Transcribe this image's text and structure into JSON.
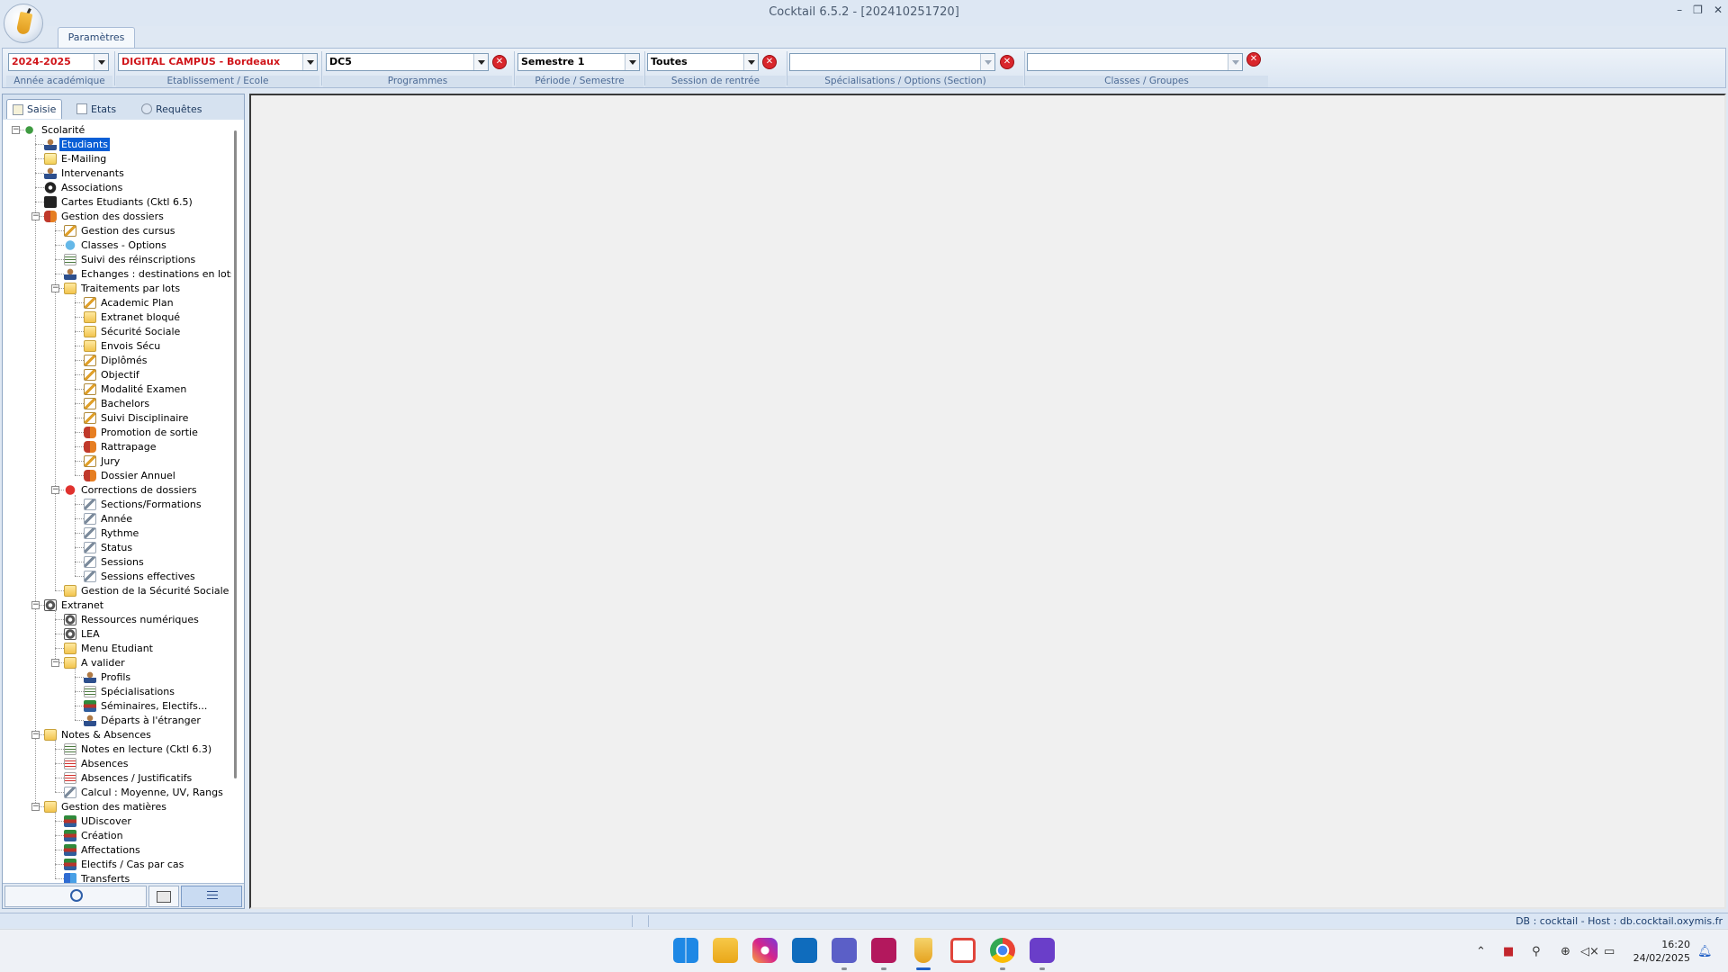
{
  "window": {
    "title": "Cocktail 6.5.2 -   [202410251720]",
    "controls": [
      "–",
      "❐",
      "✕"
    ]
  },
  "ribbon": {
    "tab_label": "Paramètres",
    "fields": [
      {
        "value": "2024-2025",
        "caption": "Année académique",
        "red": true
      },
      {
        "value": "DIGITAL CAMPUS - Bordeaux",
        "caption": "Etablissement / Ecole",
        "red": true
      },
      {
        "value": "DC5",
        "caption": "Programmes",
        "red": false
      },
      {
        "value": "Semestre 1",
        "caption": "Période / Semestre",
        "red": false
      },
      {
        "value": "Toutes",
        "caption": "Session de rentrée",
        "red": false
      },
      {
        "value": "",
        "caption": "Spécialisations / Options (Section)",
        "red": false
      },
      {
        "value": "",
        "caption": "Classes / Groupes",
        "red": false
      }
    ]
  },
  "left_panel": {
    "tabs": [
      "Saisie",
      "Etats",
      "Requêtes"
    ],
    "active_tab": "Saisie",
    "tree": [
      {
        "label": "Scolarité",
        "level": 0,
        "icon": "leaf",
        "expanded": true
      },
      {
        "label": "Etudiants",
        "level": 1,
        "icon": "person",
        "selected": true
      },
      {
        "label": "E-Mailing",
        "level": 1,
        "icon": "mail"
      },
      {
        "label": "Intervenants",
        "level": 1,
        "icon": "person"
      },
      {
        "label": "Associations",
        "level": 1,
        "icon": "ball"
      },
      {
        "label": "Cartes Etudiants (Cktl 6.5)",
        "level": 1,
        "icon": "card"
      },
      {
        "label": "Gestion des dossiers",
        "level": 1,
        "icon": "people",
        "expanded": true
      },
      {
        "label": "Gestion des cursus",
        "level": 2,
        "icon": "pencil"
      },
      {
        "label": "Classes - Options",
        "level": 2,
        "icon": "globe"
      },
      {
        "label": "Suivi des réinscriptions",
        "level": 2,
        "icon": "list"
      },
      {
        "label": "Echanges : destinations en lots",
        "level": 2,
        "icon": "person"
      },
      {
        "label": "Traitements par lots",
        "level": 2,
        "icon": "folder",
        "expanded": true
      },
      {
        "label": "Academic Plan",
        "level": 3,
        "icon": "pencil"
      },
      {
        "label": "Extranet bloqué",
        "level": 3,
        "icon": "folder"
      },
      {
        "label": "Sécurité Sociale",
        "level": 3,
        "icon": "folder"
      },
      {
        "label": "Envois Sécu",
        "level": 3,
        "icon": "folder"
      },
      {
        "label": "Diplômés",
        "level": 3,
        "icon": "pencil"
      },
      {
        "label": "Objectif",
        "level": 3,
        "icon": "pencil"
      },
      {
        "label": "Modalité Examen",
        "level": 3,
        "icon": "pencil"
      },
      {
        "label": "Bachelors",
        "level": 3,
        "icon": "pencil"
      },
      {
        "label": "Suivi Disciplinaire",
        "level": 3,
        "icon": "pencil"
      },
      {
        "label": "Promotion de sortie",
        "level": 3,
        "icon": "people"
      },
      {
        "label": "Rattrapage",
        "level": 3,
        "icon": "people"
      },
      {
        "label": "Jury",
        "level": 3,
        "icon": "pencil"
      },
      {
        "label": "Dossier Annuel",
        "level": 3,
        "icon": "people"
      },
      {
        "label": "Corrections de dossiers",
        "level": 2,
        "icon": "redball",
        "expanded": true
      },
      {
        "label": "Sections/Formations",
        "level": 3,
        "icon": "tools"
      },
      {
        "label": "Année",
        "level": 3,
        "icon": "tools"
      },
      {
        "label": "Rythme",
        "level": 3,
        "icon": "tools"
      },
      {
        "label": "Status",
        "level": 3,
        "icon": "tools"
      },
      {
        "label": "Sessions",
        "level": 3,
        "icon": "tools"
      },
      {
        "label": "Sessions effectives",
        "level": 3,
        "icon": "tools"
      },
      {
        "label": "Gestion de la Sécurité Sociale",
        "level": 2,
        "icon": "folder"
      },
      {
        "label": "Extranet",
        "level": 1,
        "icon": "gear",
        "expanded": true
      },
      {
        "label": "Ressources numériques",
        "level": 2,
        "icon": "gear"
      },
      {
        "label": "LEA",
        "level": 2,
        "icon": "gear"
      },
      {
        "label": "Menu Etudiant",
        "level": 2,
        "icon": "folder"
      },
      {
        "label": "A valider",
        "level": 2,
        "icon": "folder",
        "expanded": true
      },
      {
        "label": "Profils",
        "level": 3,
        "icon": "person"
      },
      {
        "label": "Spécialisations",
        "level": 3,
        "icon": "list"
      },
      {
        "label": "Séminaires, Electifs...",
        "level": 3,
        "icon": "books"
      },
      {
        "label": "Départs à l'étranger",
        "level": 3,
        "icon": "person"
      },
      {
        "label": "Notes & Absences",
        "level": 1,
        "icon": "folder",
        "expanded": true
      },
      {
        "label": "Notes en lecture (Cktl 6.3)",
        "level": 2,
        "icon": "list"
      },
      {
        "label": "Absences",
        "level": 2,
        "icon": "sheet"
      },
      {
        "label": "Absences / Justificatifs",
        "level": 2,
        "icon": "sheet"
      },
      {
        "label": "Calcul : Moyenne, UV, Rangs",
        "level": 2,
        "icon": "tools"
      },
      {
        "label": "Gestion des matières",
        "level": 1,
        "icon": "folder",
        "expanded": true
      },
      {
        "label": "UDiscover",
        "level": 2,
        "icon": "books"
      },
      {
        "label": "Création",
        "level": 2,
        "icon": "books"
      },
      {
        "label": "Affectations",
        "level": 2,
        "icon": "books"
      },
      {
        "label": "Electifs / Cas par cas",
        "level": 2,
        "icon": "books"
      },
      {
        "label": "Transferts",
        "level": 2,
        "icon": "transfer"
      }
    ]
  },
  "status_bar": {
    "text": "DB : cocktail - Host : db.cocktail.oxymis.fr"
  },
  "taskbar": {
    "apps": [
      "start",
      "file-explorer",
      "instagram",
      "outlook",
      "teams",
      "harvest",
      "cocktail",
      "snipping-tool",
      "chrome",
      "qobuz"
    ],
    "active_app": "cocktail",
    "time": "16:20",
    "date": "24/02/2025"
  }
}
